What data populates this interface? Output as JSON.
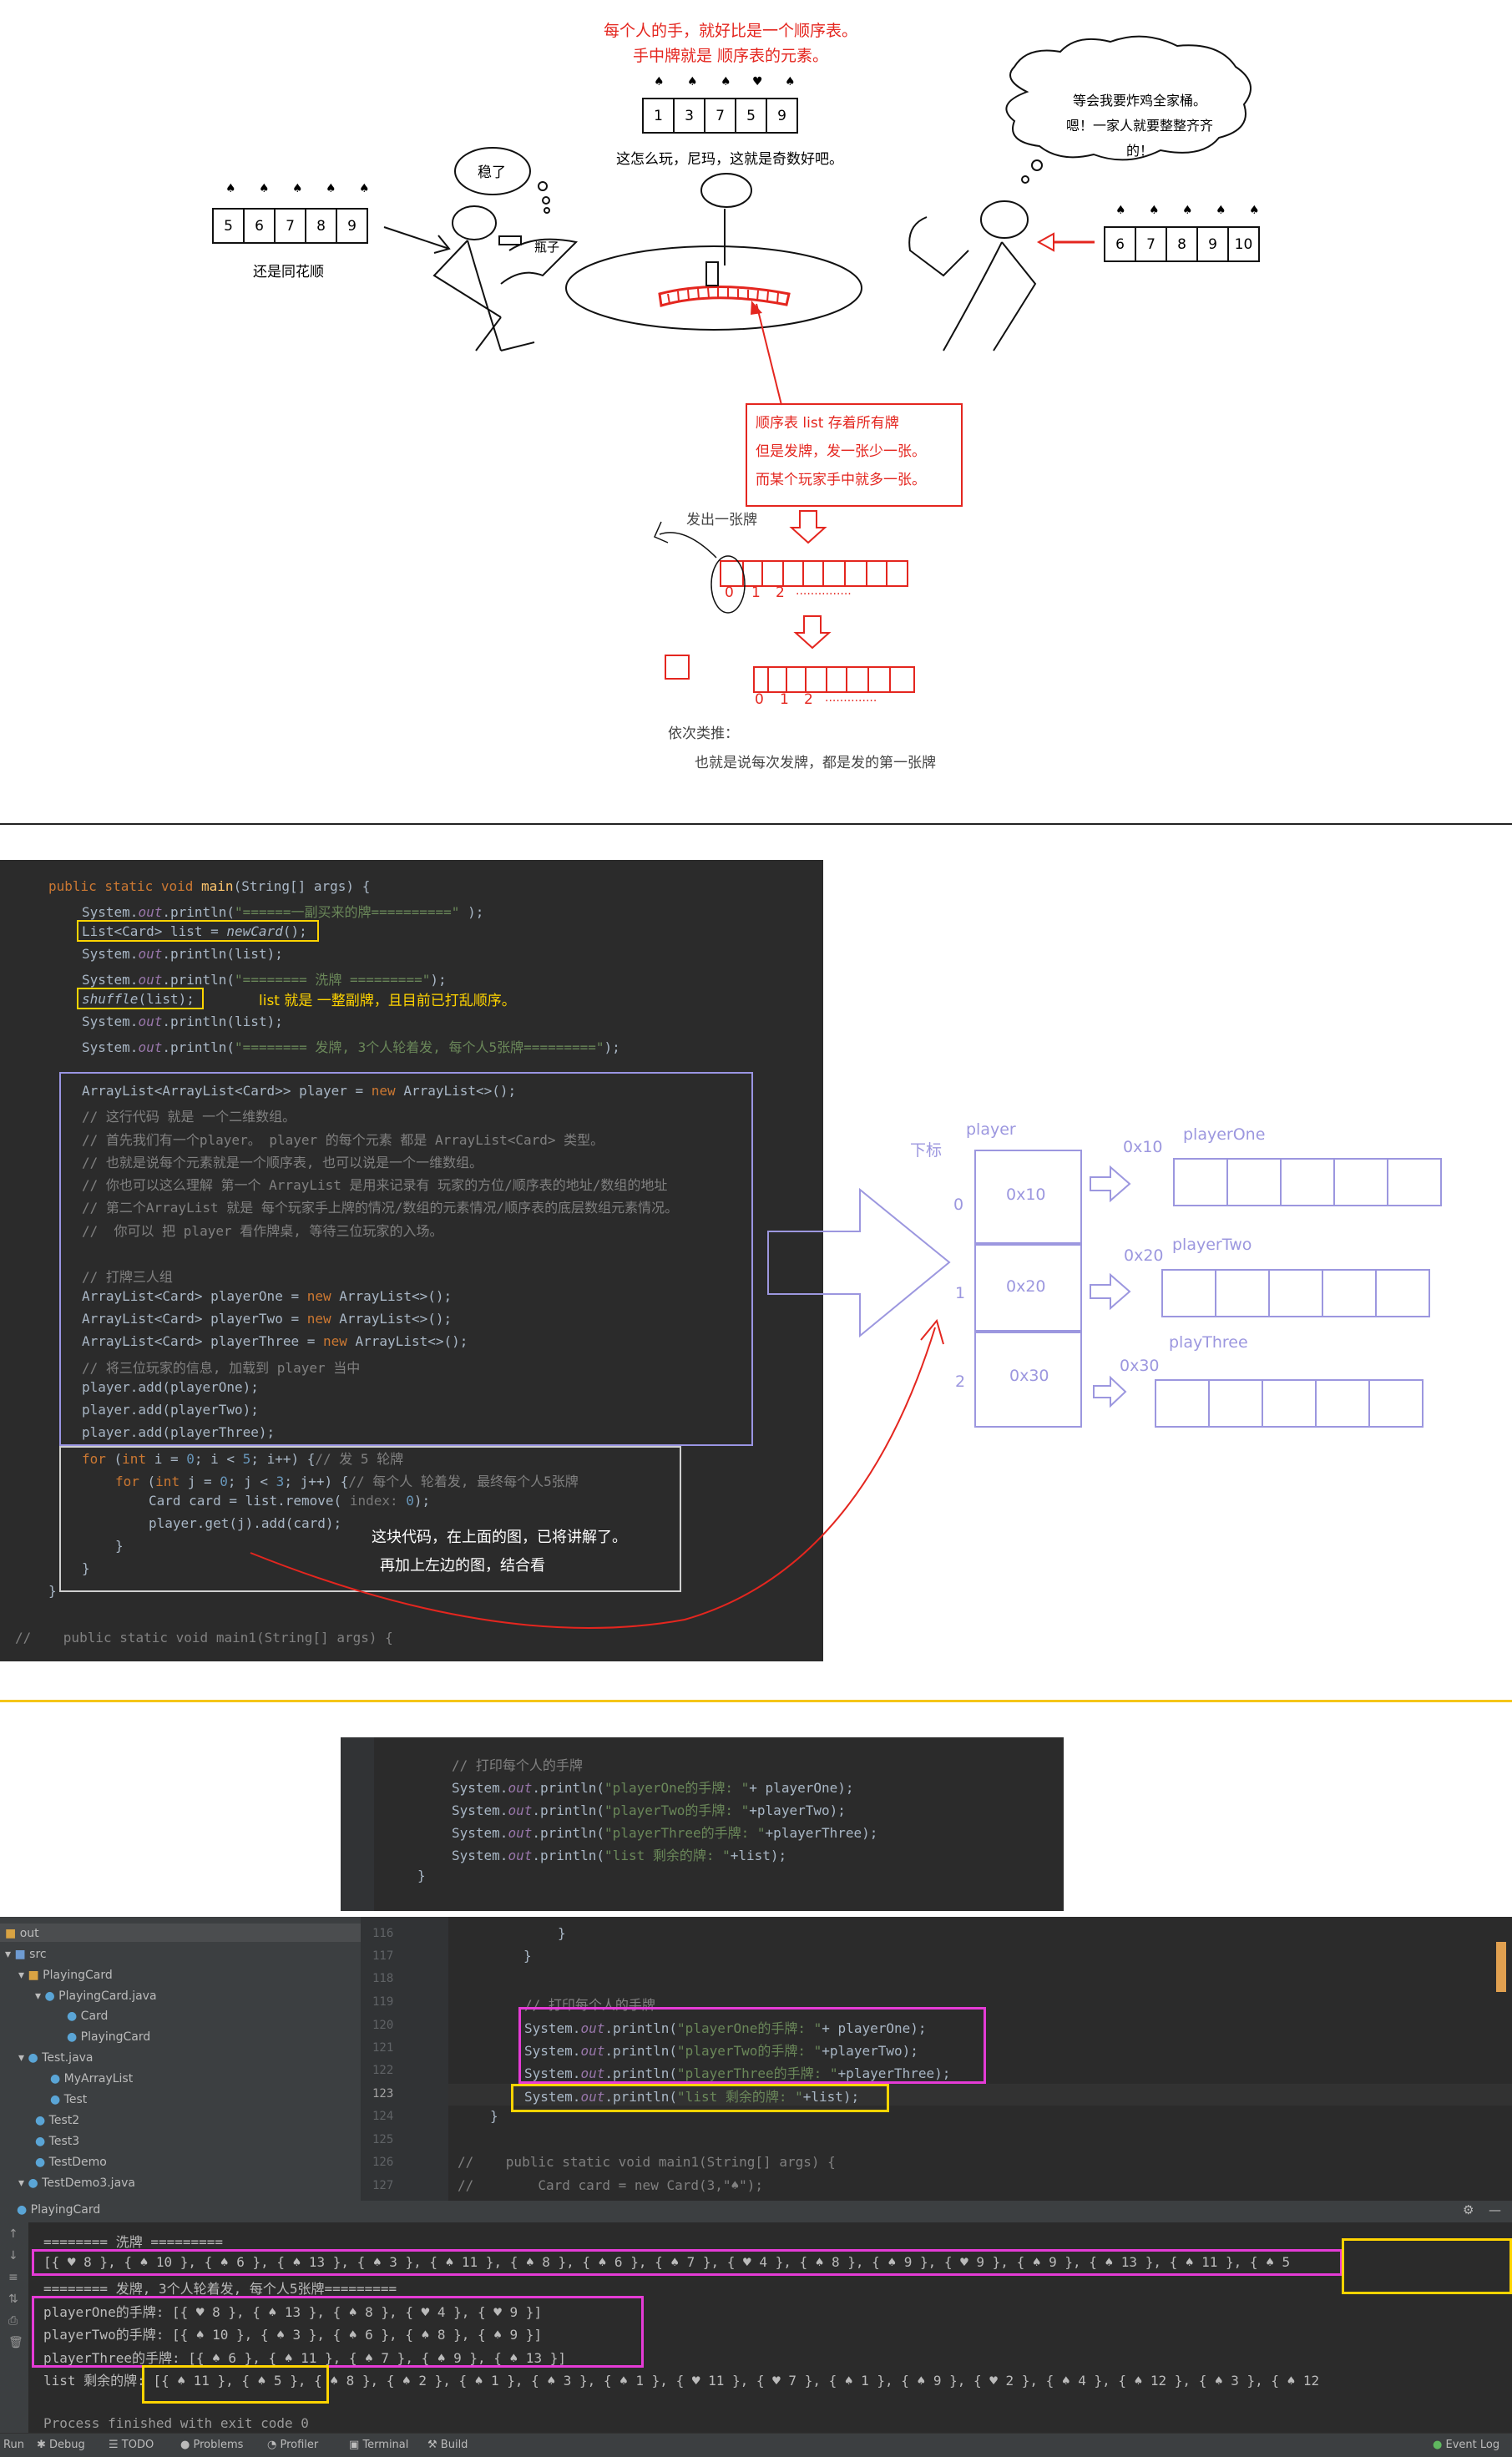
{
  "diagram": {
    "top_note": [
      "每个人的手，就好比是一个顺序表。",
      "手中牌就是 顺序表的元素。"
    ],
    "center_cards": [
      "1",
      "3",
      "7",
      "5",
      "9"
    ],
    "center_caption": "这怎么玩，尼玛，这就是奇数好吧。",
    "left_cards": [
      "5",
      "6",
      "7",
      "8",
      "9"
    ],
    "left_caption": "还是同花顺",
    "left_bubble": "稳了",
    "left_bottle": "瓶子",
    "right_cards": [
      "6",
      "7",
      "8",
      "9",
      "10"
    ],
    "right_bubble": [
      "等会我要炸鸡全家桶。",
      "嗯！一家人就要整整齐齐的！"
    ],
    "list_note": [
      "顺序表 list 存着所有牌",
      "但是发牌，发一张少一张。",
      "而某个玩家手中就多一张。"
    ],
    "deal_label": "发出一张牌",
    "indices_1": [
      "0",
      "1",
      "2",
      "..............."
    ],
    "indices_2": [
      "0",
      "1",
      "2",
      ".............."
    ],
    "bottom_note": [
      "依次类推：",
      "也就是说每次发牌，都是发的第一张牌"
    ]
  },
  "code_main": {
    "lines": [
      "public static void main(String[] args) {",
      "System.out.println(\"======一副买来的牌==========\");",
      "List<Card> list = newCard();",
      "System.out.println(list);",
      "System.out.println(\"======== 洗牌 =========\");",
      "shuffle(list);",
      "System.out.println(list);",
      "System.out.println(\"======== 发牌, 3个人轮着发, 每个人5张牌=========\");",
      "ArrayList<ArrayList<Card>> player = new ArrayList<>();",
      "// 这行代码 就是 一个二维数组。",
      "// 首先我们有一个player。 player 的每个元素 都是 ArrayList<Card> 类型。",
      "// 也就是说每个元素就是一个顺序表, 也可以说是一个一维数组。",
      "// 你也可以这么理解 第一个 ArrayList 是用来记录有 玩家的方位/顺序表的地址/数组的地址",
      "// 第二个ArrayList 就是 每个玩家手上牌的情况/数组的元素情况/顺序表的底层数组元素情况。",
      "//  你可以 把 player 看作牌桌, 等待三位玩家的入场。",
      "// 打牌三人组",
      "ArrayList<Card> playerOne = new ArrayList<>();",
      "ArrayList<Card> playerTwo = new ArrayList<>();",
      "ArrayList<Card> playerThree = new ArrayList<>();",
      "// 将三位玩家的信息, 加载到 player 当中",
      "player.add(playerOne);",
      "player.add(playerTwo);",
      "player.add(playerThree);",
      "for (int i = 0; i < 5; i++) {// 发 5 轮牌",
      "for (int j = 0; j < 3; j++) {// 每个人 轮着发, 最终每个人5张牌",
      "Card card = list.remove( index: 0);",
      "player.get(j).add(card);",
      "}",
      "}",
      "}",
      "//    public static void main1(String[] args) {"
    ],
    "shuffle_note": "list 就是 一整副牌，且目前已打乱顺序。",
    "loop_note": [
      "这块代码，在上面的图，已将讲解了。",
      "再加上左边的图，结合看"
    ]
  },
  "player_diagram": {
    "index_label": "下标",
    "player_label": "player",
    "indices": [
      "0",
      "1",
      "2"
    ],
    "addresses": [
      "0x10",
      "0x20",
      "0x30"
    ],
    "players": [
      "playerOne",
      "playerTwo",
      "playThree"
    ]
  },
  "code_print": {
    "lines": [
      "// 打印每个人的手牌",
      "System.out.println(\"playerOne的手牌: \"+ playerOne);",
      "System.out.println(\"playerTwo的手牌: \"+playerTwo);",
      "System.out.println(\"playerThree的手牌: \"+playerThree);",
      "System.out.println(\"list 剩余的牌: \"+list);",
      "}"
    ]
  },
  "ide": {
    "tree": [
      "out",
      "src",
      "PlayingCard",
      "PlayingCard.java",
      "Card",
      "PlayingCard",
      "Test.java",
      "MyArrayList",
      "Test",
      "Test2",
      "Test3",
      "TestDemo",
      "TestDemo3.java"
    ],
    "line_numbers": [
      "116",
      "117",
      "118",
      "119",
      "120",
      "121",
      "122",
      "123",
      "124",
      "125",
      "126",
      "127"
    ],
    "editor_lines": [
      "}",
      "}",
      "",
      "// 打印每个人的手牌",
      "System.out.println(\"playerOne的手牌: \"+ playerOne);",
      "System.out.println(\"playerTwo的手牌: \"+playerTwo);",
      "System.out.println(\"playerThree的手牌: \"+playerThree);",
      "System.out.println(\"list 剩余的牌: \"+list);",
      "}",
      "",
      "//    public static void main1(String[] args) {",
      "//        Card card = new Card(3,\"♠\");"
    ],
    "run_tab": "PlayingCard",
    "output": [
      "======== 洗牌 =========",
      "[{ ♥ 8 }, { ♠ 10 }, { ♠ 6 }, { ♠ 13 }, { ♠ 3 }, { ♠ 11 }, { ♠ 8 }, { ♠ 6 }, { ♠ 7 }, { ♥ 4 }, { ♠ 8 }, { ♠ 9 }, { ♥ 9 }, { ♠ 9 }, { ♠ 13 }, { ♠ 11 }, { ♠ 5",
      "======== 发牌, 3个人轮着发, 每个人5张牌=========",
      "playerOne的手牌: [{ ♥ 8 }, { ♠ 13 }, { ♠ 8 }, { ♥ 4 }, { ♥ 9 }]",
      "playerTwo的手牌: [{ ♠ 10 }, { ♠ 3 }, { ♠ 6 }, { ♠ 8 }, { ♠ 9 }]",
      "playerThree的手牌: [{ ♠ 6 }, { ♠ 11 }, { ♠ 7 }, { ♠ 9 }, { ♠ 13 }]",
      "list 剩余的牌: [{ ♠ 11 }, { ♠ 5 }, { ♠ 8 }, { ♠ 2 }, { ♠ 1 }, { ♠ 3 }, { ♠ 1 }, { ♥ 11 }, { ♥ 7 }, { ♠ 1 }, { ♠ 9 }, { ♥ 2 }, { ♠ 4 }, { ♠ 12 }, { ♠ 3 }, { ♠ 12",
      "",
      "Process finished with exit code 0"
    ],
    "statusbar": [
      "Run",
      "Debug",
      "TODO",
      "Problems",
      "Profiler",
      "Terminal",
      "Build",
      "Event Log"
    ]
  },
  "colors": {
    "red": "#e4261f",
    "yellow": "#ffd400",
    "magenta": "#e53bd6",
    "lavender": "#9c97df",
    "ide_bg": "#2b2b2b"
  }
}
